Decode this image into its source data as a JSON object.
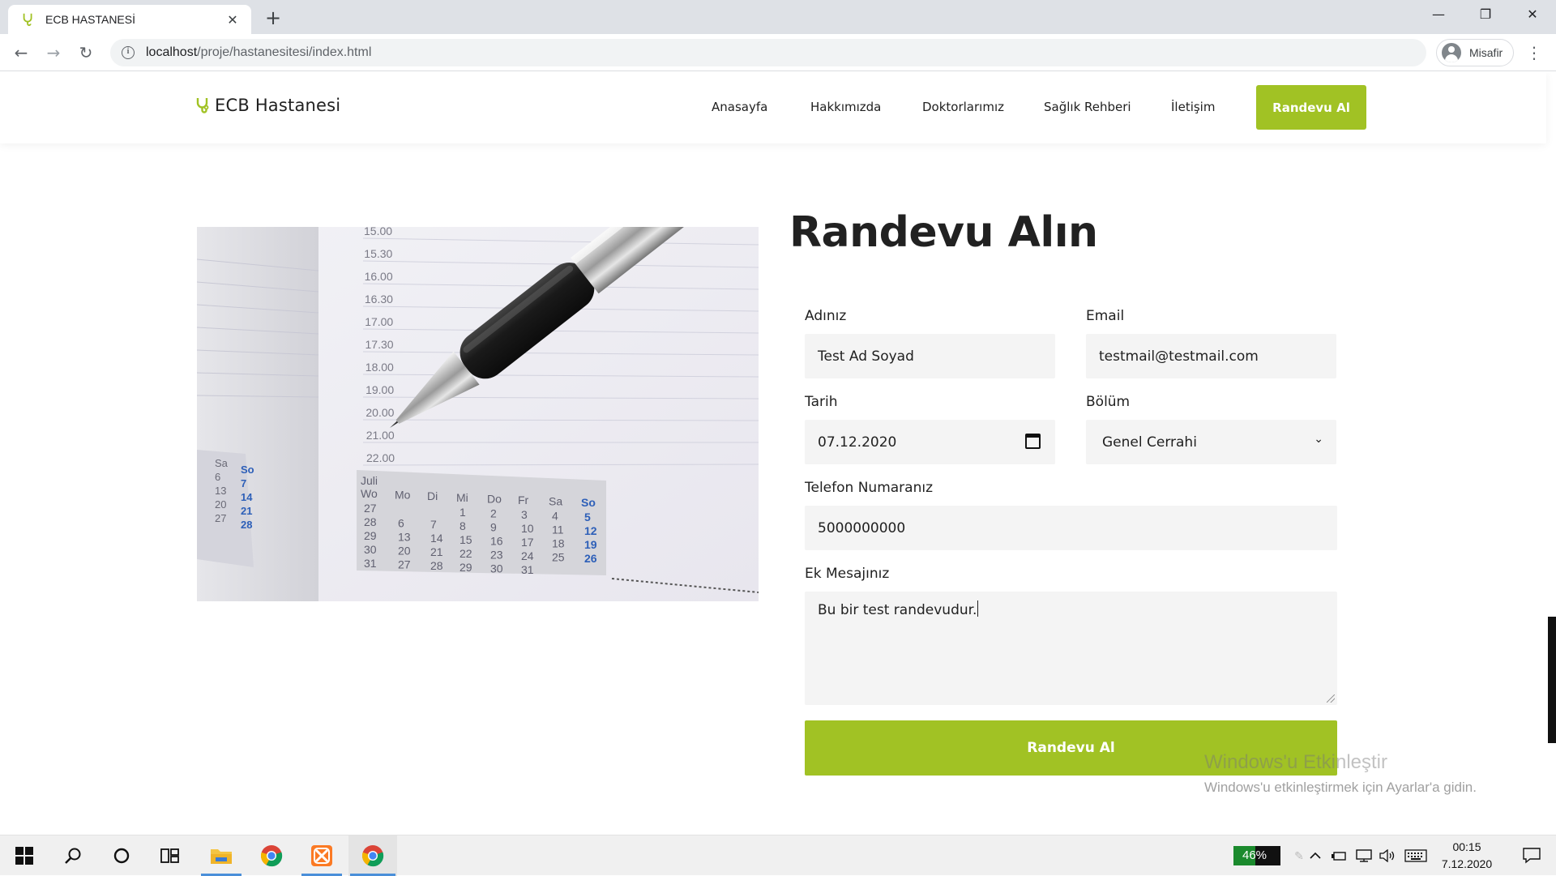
{
  "browser": {
    "tab_title": "ECB HASTANESİ",
    "tab_close": "✕",
    "new_tab": "+",
    "url_host": "localhost",
    "url_path": "/proje/hastanesitesi/index.html",
    "profile_name": "Misafir",
    "window_controls": {
      "minimize": "—",
      "restore": "❐",
      "close": "✕"
    },
    "nav": {
      "back": "←",
      "forward": "→",
      "reload": "↻",
      "menu": "⋮",
      "info": "i"
    }
  },
  "site": {
    "brand": "ECB Hastanesi",
    "brand_color": "#a1c224",
    "menu": [
      "Anasayfa",
      "Hakkımızda",
      "Doktorlarımız",
      "Sağlık Rehberi",
      "İletişim"
    ],
    "cta": "Randevu Al"
  },
  "form": {
    "title": "Randevu Alın",
    "name_label": "Adınız",
    "name_value": "Test Ad Soyad",
    "email_label": "Email",
    "email_value": "testmail@testmail.com",
    "date_label": "Tarih",
    "date_value": "07.12.2020",
    "dept_label": "Bölüm",
    "dept_value": "Genel Cerrahi",
    "phone_label": "Telefon Numaranız",
    "phone_value": "5000000000",
    "message_label": "Ek Mesajınız",
    "message_value": "Bu bir test randevudur.",
    "submit": "Randevu Al"
  },
  "watermark": {
    "title": "Windows'u Etkinleştir",
    "subtitle": "Windows'u etkinleştirmek için Ayarlar'a gidin."
  },
  "taskbar": {
    "battery_percent": 46,
    "battery_label": "46%",
    "time": "00:15",
    "date": "7.12.2020",
    "tray_icons": [
      "chevron-up-icon",
      "battery-plug-icon",
      "network-icon",
      "volume-icon",
      "keyboard-icon"
    ]
  },
  "image": {
    "times": [
      "15.00",
      "15.30",
      "16.00",
      "16.30",
      "17.00",
      "17.30",
      "18.00",
      "19.00",
      "20.00",
      "21.00",
      "22.00"
    ],
    "month": "Juli",
    "weekdays": [
      "Wo",
      "Mo",
      "Di",
      "Mi",
      "Do",
      "Fr",
      "Sa",
      "So"
    ],
    "weeks": [
      [
        "27",
        "",
        "",
        "1",
        "2",
        "3",
        "4",
        "5"
      ],
      [
        "28",
        "6",
        "7",
        "8",
        "9",
        "10",
        "11",
        "12"
      ],
      [
        "29",
        "13",
        "14",
        "15",
        "16",
        "17",
        "18",
        "19"
      ],
      [
        "30",
        "20",
        "21",
        "22",
        "23",
        "24",
        "25",
        "26"
      ],
      [
        "31",
        "27",
        "28",
        "29",
        "30",
        "31",
        "",
        ""
      ]
    ],
    "side_days": [
      [
        "Sa",
        "So"
      ],
      [
        "6",
        "7"
      ],
      [
        "13",
        "14"
      ],
      [
        "20",
        "21"
      ],
      [
        "27",
        "28"
      ]
    ]
  }
}
